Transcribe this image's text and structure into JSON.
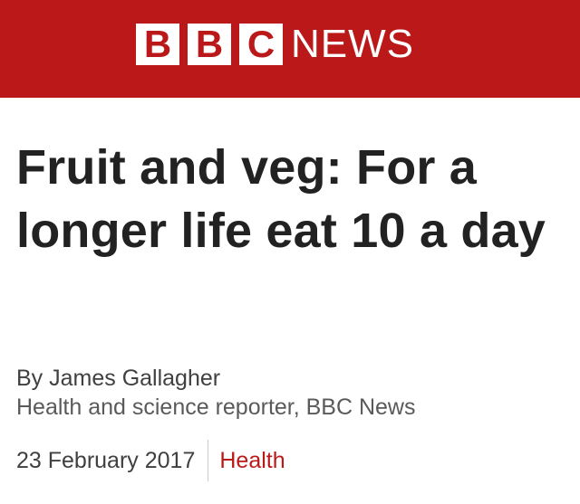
{
  "header": {
    "logo_letters": [
      "B",
      "B",
      "C"
    ],
    "logo_news": "NEWS",
    "brand_color": "#bb1919"
  },
  "article": {
    "headline": "Fruit and veg: For a longer life eat 10 a day",
    "byline_name": "By James Gallagher",
    "byline_role": "Health and science reporter, BBC News",
    "date": "23 February 2017",
    "section": "Health"
  }
}
